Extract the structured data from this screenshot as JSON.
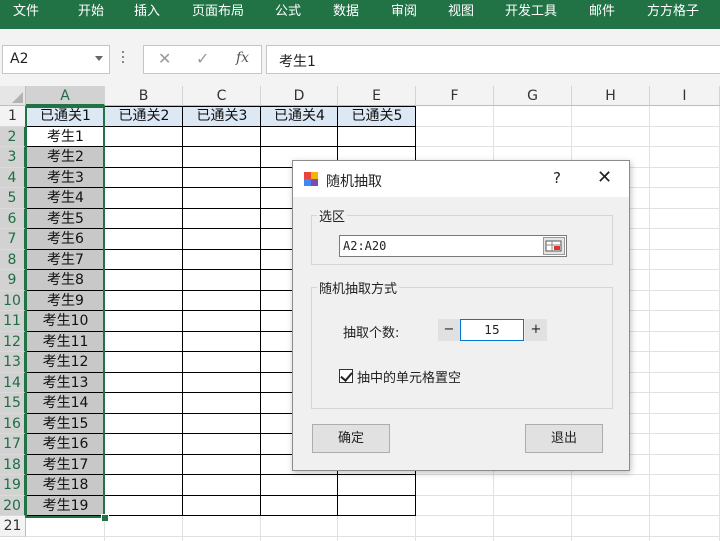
{
  "ribbon": {
    "tabs": [
      "文件",
      "开始",
      "插入",
      "页面布局",
      "公式",
      "数据",
      "审阅",
      "视图",
      "开发工具",
      "邮件",
      "方方格子"
    ],
    "color": "#217346"
  },
  "formula_bar": {
    "name_box": "A2",
    "cancel_glyph": "✕",
    "enter_glyph": "✓",
    "fx_label": "fx",
    "content": "考生1"
  },
  "sheet": {
    "columns": [
      "A",
      "B",
      "C",
      "D",
      "E",
      "F",
      "G",
      "H",
      "I"
    ],
    "rows": [
      "1",
      "2",
      "3",
      "4",
      "5",
      "6",
      "7",
      "8",
      "9",
      "10",
      "11",
      "12",
      "13",
      "14",
      "15",
      "16",
      "17",
      "18",
      "19",
      "20",
      "21"
    ],
    "headers": [
      "已通关1",
      "已通关2",
      "已通关3",
      "已通关4",
      "已通关5"
    ],
    "col_a_values": [
      "考生1",
      "考生2",
      "考生3",
      "考生4",
      "考生5",
      "考生6",
      "考生7",
      "考生8",
      "考生9",
      "考生10",
      "考生11",
      "考生12",
      "考生13",
      "考生14",
      "考生15",
      "考生16",
      "考生17",
      "考生18",
      "考生19"
    ],
    "header_fill": "#dde8f5",
    "selection_color": "#217346"
  },
  "dialog": {
    "title": "随机抽取",
    "help": "?",
    "close": "✕",
    "selection_group_label": "选区",
    "range_value": "A2:A20",
    "method_group_label": "随机抽取方式",
    "count_label": "抽取个数:",
    "minus": "−",
    "count_value": "15",
    "plus": "+",
    "clear_checkbox_label": "抽中的单元格置空",
    "clear_checked": true,
    "ok_label": "确定",
    "exit_label": "退出"
  }
}
